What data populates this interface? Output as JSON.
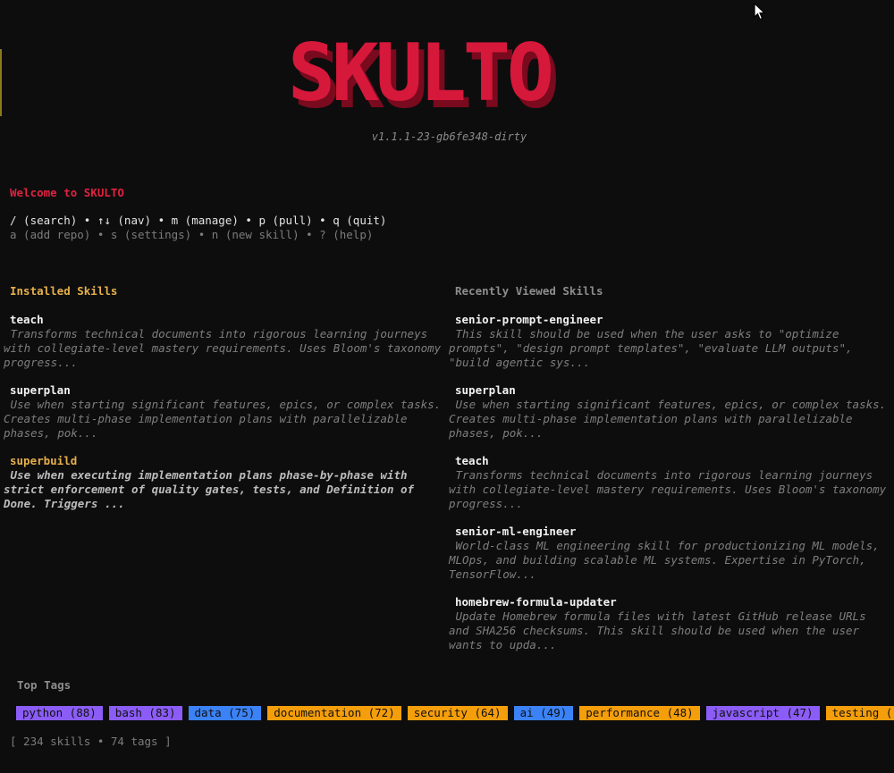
{
  "app": {
    "logo_text": "SKULTO",
    "version": "v1.1.1-23-gb6fe348-dirty"
  },
  "colors": {
    "logo_red": "#d6183a",
    "logo_shadow": "#7a0a1e",
    "selected_yellow": "#e6b04a",
    "tag_purple": "#8b5cf6",
    "tag_blue": "#3b82f6",
    "tag_orange": "#f59e0b"
  },
  "welcome": {
    "title": "Welcome to SKULTO",
    "primary_keys": "/ (search) • ↑↓ (nav) • m (manage) • p (pull) • q (quit)",
    "secondary_keys": "a (add repo) • s (settings) • n (new skill) • ? (help)"
  },
  "installed": {
    "title": "Installed Skills",
    "skills": [
      {
        "name": "teach",
        "desc": " Transforms technical documents into rigorous learning journeys\nwith collegiate-level mastery requirements. Uses Bloom's taxonomy\nprogress..."
      },
      {
        "name": "superplan",
        "desc": " Use when starting significant features, epics, or complex tasks.\nCreates multi-phase implementation plans with parallelizable\nphases, pok..."
      },
      {
        "name": "superbuild",
        "desc": " Use when executing implementation plans phase-by-phase with\nstrict enforcement of quality gates, tests, and Definition of\nDone. Triggers ..."
      }
    ]
  },
  "recent": {
    "title": "Recently Viewed Skills",
    "skills": [
      {
        "name": "senior-prompt-engineer",
        "desc": " This skill should be used when the user asks to \"optimize\nprompts\", \"design prompt templates\", \"evaluate LLM outputs\",\n\"build agentic sys..."
      },
      {
        "name": "superplan",
        "desc": " Use when starting significant features, epics, or complex tasks.\nCreates multi-phase implementation plans with parallelizable\nphases, pok..."
      },
      {
        "name": "teach",
        "desc": " Transforms technical documents into rigorous learning journeys\nwith collegiate-level mastery requirements. Uses Bloom's taxonomy\nprogress..."
      },
      {
        "name": "senior-ml-engineer",
        "desc": " World-class ML engineering skill for productionizing ML models,\nMLOps, and building scalable ML systems. Expertise in PyTorch,\nTensorFlow..."
      },
      {
        "name": "homebrew-formula-updater",
        "desc": " Update Homebrew formula files with latest GitHub release URLs\nand SHA256 checksums. This skill should be used when the user\nwants to upda..."
      }
    ]
  },
  "tags": {
    "title": "Top Tags",
    "items": [
      {
        "label": "python (88)",
        "color": "#8b5cf6"
      },
      {
        "label": "bash (83)",
        "color": "#8b5cf6"
      },
      {
        "label": "data (75)",
        "color": "#3b82f6"
      },
      {
        "label": "documentation (72)",
        "color": "#f59e0b"
      },
      {
        "label": "security (64)",
        "color": "#f59e0b"
      },
      {
        "label": "ai (49)",
        "color": "#3b82f6"
      },
      {
        "label": "performance (48)",
        "color": "#f59e0b"
      },
      {
        "label": "javascript (47)",
        "color": "#8b5cf6"
      },
      {
        "label": "testing (",
        "color": "#f59e0b"
      }
    ]
  },
  "status": {
    "text": "[ 234 skills • 74 tags ]"
  }
}
